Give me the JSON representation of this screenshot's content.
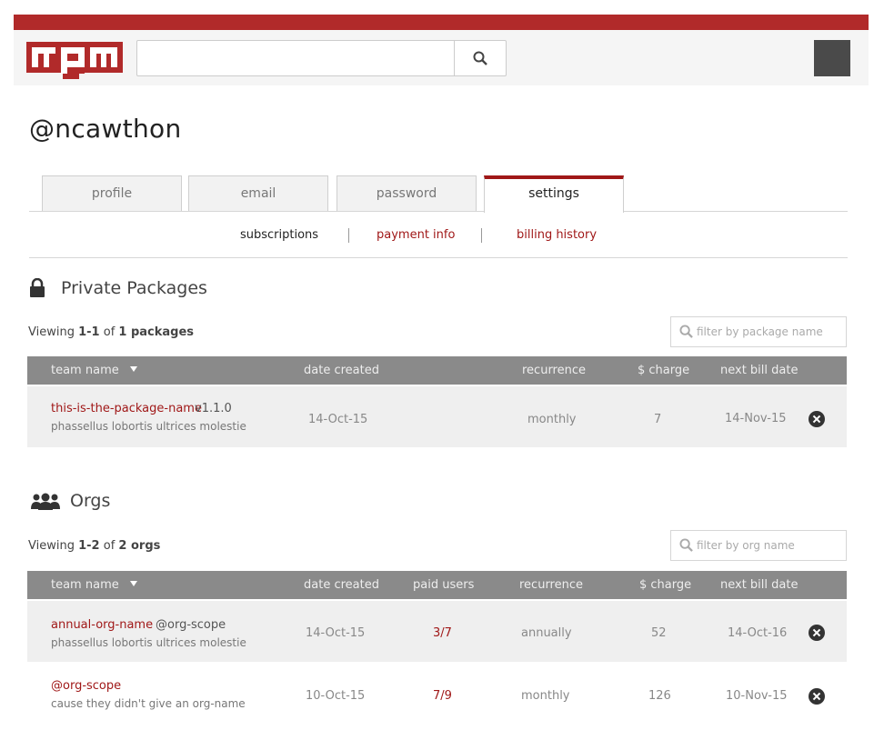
{
  "colors": {
    "brand": "#b12a2a",
    "link": "#a01818",
    "header_bg": "#f5f5f5",
    "table_header": "#8a8a8a"
  },
  "header": {
    "logo_text": "npm",
    "search_placeholder": "",
    "search_icon": "search-icon"
  },
  "user": {
    "handle": "@ncawthon"
  },
  "tabs": [
    {
      "label": "profile",
      "active": false
    },
    {
      "label": "email",
      "active": false
    },
    {
      "label": "password",
      "active": false
    },
    {
      "label": "settings",
      "active": true
    }
  ],
  "subnav": [
    {
      "label": "subscriptions",
      "active": true
    },
    {
      "label": "payment info",
      "active": false
    },
    {
      "label": "billing history",
      "active": false
    }
  ],
  "private_packages": {
    "title": "Private Packages",
    "viewing_prefix": "Viewing",
    "viewing_range": "1-1",
    "viewing_of": "of",
    "viewing_count": "1 packages",
    "filter_placeholder": "filter by package name",
    "columns": [
      "team name",
      "date created",
      "recurrence",
      "$ charge",
      "next bill date"
    ],
    "rows": [
      {
        "name": "this-is-the-package-name",
        "version": "v1.1.0",
        "desc": "phassellus lobortis ultrices molestie",
        "date_created": "14-Oct-15",
        "recurrence": "monthly",
        "charge": "7",
        "next_bill": "14-Nov-15"
      }
    ]
  },
  "orgs": {
    "title": "Orgs",
    "viewing_prefix": "Viewing",
    "viewing_range": "1-2",
    "viewing_of": "of",
    "viewing_count": "2 orgs",
    "filter_placeholder": "filter by org name",
    "columns": [
      "team name",
      "date created",
      "paid users",
      "recurrence",
      "$ charge",
      "next bill date"
    ],
    "rows": [
      {
        "name": "annual-org-name",
        "scope": "@org-scope",
        "desc": "phassellus lobortis ultrices molestie",
        "date_created": "14-Oct-15",
        "paid_users": "3/7",
        "recurrence": "annually",
        "charge": "52",
        "next_bill": "14-Oct-16"
      },
      {
        "name": "@org-scope",
        "scope": "",
        "desc": "cause they didn't give an org-name",
        "date_created": "10-Oct-15",
        "paid_users": "7/9",
        "recurrence": "monthly",
        "charge": "126",
        "next_bill": "10-Nov-15"
      }
    ]
  }
}
